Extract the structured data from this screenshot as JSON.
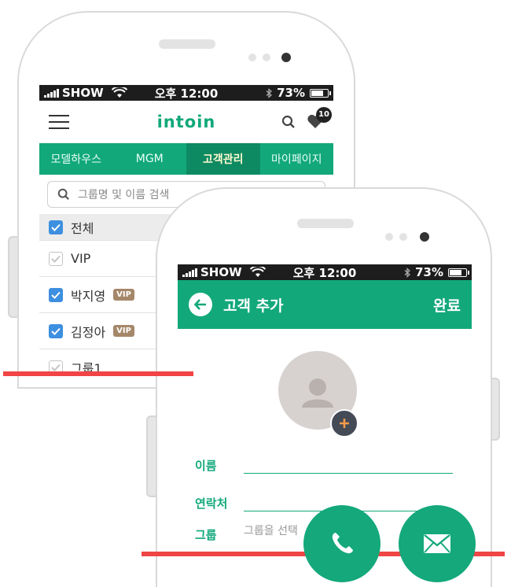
{
  "back_phone": {
    "status": {
      "carrier": "SHOW",
      "time": "오후 12:00",
      "battery": "73%"
    },
    "logo": "intoin",
    "notification_count": "10",
    "tabs": [
      "모델하우스",
      "MGM",
      "고객관리",
      "마이페이지"
    ],
    "active_tab": "고객관리",
    "search_placeholder": "그룹명 및 이름 검색",
    "list": [
      {
        "label": "전체",
        "checked": true,
        "vip": false
      },
      {
        "label": "VIP",
        "checked": false,
        "vip": false
      },
      {
        "label": "박지영",
        "checked": true,
        "vip": true
      },
      {
        "label": "김정아",
        "checked": true,
        "vip": true
      },
      {
        "label": "그룹1",
        "checked": false,
        "vip": false
      }
    ],
    "vip_badge": "VIP"
  },
  "front_phone": {
    "status": {
      "carrier": "SHOW",
      "time": "오후 12:00",
      "battery": "73%"
    },
    "title": "고객 추가",
    "done": "완료",
    "fields": {
      "name_label": "이름",
      "contact_label": "연락처",
      "group_label": "그룹",
      "group_placeholder": "그룹을 선택"
    }
  },
  "colors": {
    "accent": "#12a87a",
    "accent_dark": "#0e8a63",
    "red_line": "#f04545",
    "fab": "#14a87b"
  },
  "icons": [
    "wifi-icon",
    "bluetooth-icon",
    "battery-icon",
    "menu-icon",
    "search-icon",
    "heart-icon",
    "check-icon",
    "back-arrow-icon",
    "person-icon",
    "plus-icon",
    "phone-icon",
    "mail-icon"
  ]
}
